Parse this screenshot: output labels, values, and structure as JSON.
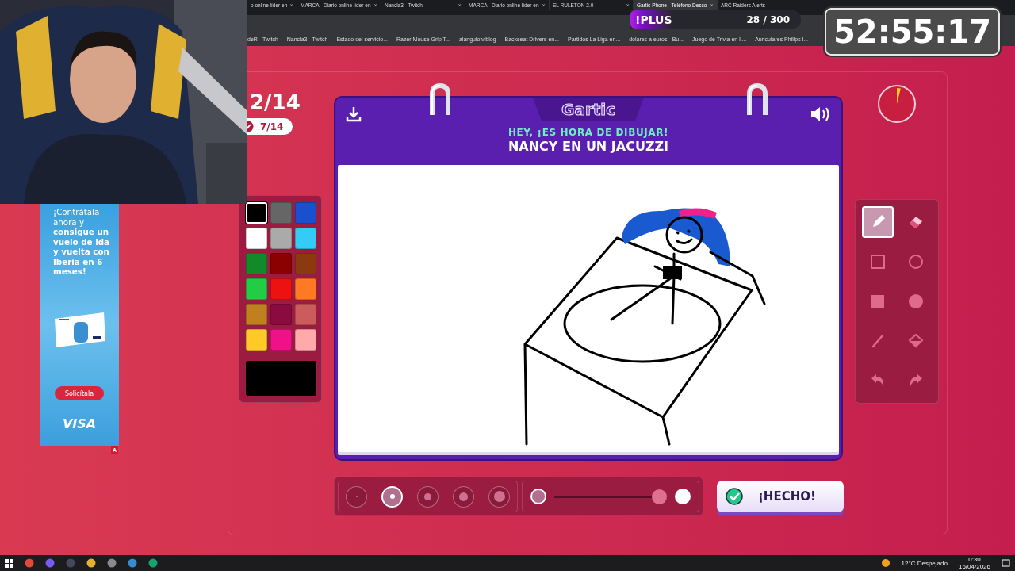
{
  "browser": {
    "tabs": [
      {
        "title": "o online líder en",
        "close": "×",
        "selected": false
      },
      {
        "title": "MARCA - Diario online líder en",
        "close": "×",
        "selected": false
      },
      {
        "title": "Nancla3 - Twitch",
        "close": "×",
        "selected": false
      },
      {
        "title": "MARCA - Diario online líder en",
        "close": "×",
        "selected": false
      },
      {
        "title": "EL RULETON 2.0",
        "close": "×",
        "selected": false
      },
      {
        "title": "Gartic Phone - Teléfono Desco",
        "close": "×",
        "selected": true
      },
      {
        "title": "ARC Raiders Alerts",
        "selected": false
      }
    ],
    "bookmarks": [
      "deR - Twitch",
      "Nancla3 - Twitch",
      "Estado del servicio...",
      "Razer Mouse Grip T...",
      "alangulotv.blog",
      "Backseat Drivers en...",
      "Partidos La Liga en...",
      "dolares a euros - Bu...",
      "Juego de Trivia en li...",
      "Auriculares Philips l..."
    ]
  },
  "stream_overlay": {
    "plus_badge": {
      "label": "!PLUS",
      "count": "28 / 300"
    },
    "timer": "52:55:17",
    "ad": {
      "text": "¡Contrátala ahora y **consigue un vuelo de ida y vuelta con Iberia en 6 meses!**",
      "button": "Solicítala",
      "brand": "VISA",
      "badge": "A"
    }
  },
  "game": {
    "round": "2/14",
    "done_count": "7/14",
    "header": {
      "logo": "Gartic",
      "prompt_label": "HEY, ¡ES HORA DE DIBUJAR!",
      "prompt": "NANCY EN UN JACUZZI"
    },
    "palette": [
      {
        "color": "#000000",
        "selected": true
      },
      {
        "color": "#666666",
        "selected": false
      },
      {
        "color": "#1a4fcf",
        "selected": false
      },
      {
        "color": "#ffffff",
        "selected": false
      },
      {
        "color": "#aaaaaa",
        "selected": false
      },
      {
        "color": "#33ccf5",
        "selected": false
      },
      {
        "color": "#138a2a",
        "selected": false
      },
      {
        "color": "#8b0000",
        "selected": false
      },
      {
        "color": "#8b3a10",
        "selected": false
      },
      {
        "color": "#22cc44",
        "selected": false
      },
      {
        "color": "#ee1111",
        "selected": false
      },
      {
        "color": "#ff7a22",
        "selected": false
      },
      {
        "color": "#c08020",
        "selected": false
      },
      {
        "color": "#8b0a40",
        "selected": false
      },
      {
        "color": "#cc5c5c",
        "selected": false
      },
      {
        "color": "#ffc928",
        "selected": false
      },
      {
        "color": "#ee1188",
        "selected": false
      },
      {
        "color": "#ffaaaa",
        "selected": false
      }
    ],
    "tools": [
      {
        "kind": "pencil",
        "selected": true
      },
      {
        "kind": "eraser",
        "selected": false
      },
      {
        "kind": "rectangle",
        "selected": false
      },
      {
        "kind": "ellipse",
        "selected": false
      },
      {
        "kind": "filled-rectangle",
        "selected": false
      },
      {
        "kind": "filled-ellipse",
        "selected": false
      },
      {
        "kind": "line",
        "selected": false
      },
      {
        "kind": "bucket",
        "selected": false
      },
      {
        "kind": "undo",
        "selected": false
      },
      {
        "kind": "redo",
        "selected": false
      }
    ],
    "brush_sizes": [
      {
        "selected": false
      },
      {
        "selected": true
      },
      {
        "selected": false
      },
      {
        "selected": false
      },
      {
        "selected": false
      }
    ],
    "opacity": {
      "level": 1
    },
    "done_button": "¡HECHO!"
  },
  "taskbar": {
    "weather": "12°C Despejado",
    "time": "0:30",
    "date": "16/04/2026"
  }
}
